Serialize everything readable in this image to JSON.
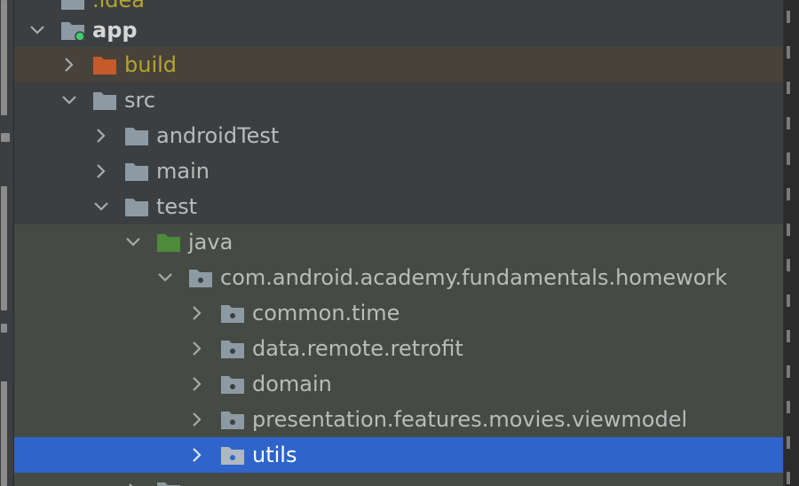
{
  "tree": {
    "rows": [
      {
        "label": "app"
      },
      {
        "label": "build"
      },
      {
        "label": "src"
      },
      {
        "label": "androidTest"
      },
      {
        "label": "main"
      },
      {
        "label": "test"
      },
      {
        "label": "java"
      },
      {
        "label": "com.android.academy.fundamentals.homework"
      },
      {
        "label": "common.time"
      },
      {
        "label": "data.remote.retrofit"
      },
      {
        "label": "domain"
      },
      {
        "label": "presentation.features.movies.viewmodel"
      },
      {
        "label": "utils"
      }
    ],
    "partial_top_label": ".idea"
  },
  "colors": {
    "background": "#3c3f41",
    "selection": "#2f65ca",
    "test_source_tint": "#454a45",
    "excluded_tint": "#47423a",
    "excluded_folder": "#c55a2b",
    "test_root_folder": "#4d8a3a",
    "module_dot": "#3fcf6a"
  }
}
